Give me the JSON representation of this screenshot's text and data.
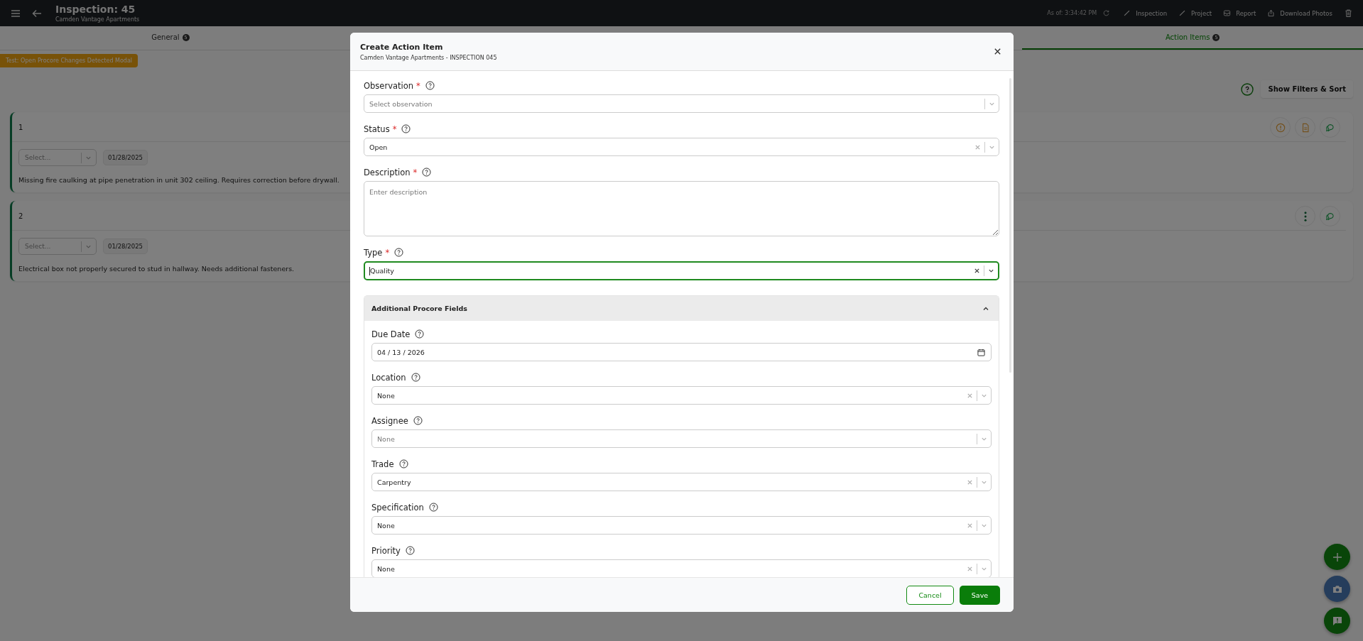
{
  "header": {
    "title": "Inspection: 45",
    "subtitle": "Camden Vantage Apartments",
    "as_of": "As of: 3:34:42 PM",
    "actions": [
      {
        "kind": "pencil",
        "label": "Inspection"
      },
      {
        "kind": "pencil",
        "label": "Project"
      },
      {
        "kind": "report",
        "label": "Report"
      },
      {
        "kind": "upload",
        "label": "Download Photos"
      }
    ]
  },
  "tabs": [
    {
      "label": "General",
      "badge": "5",
      "selected": false
    },
    {
      "label": "Action Items",
      "badge": "5",
      "selected": true
    }
  ],
  "test_button": "Test: Open Procore Changes Detected Modal",
  "filters_button": "Show Filters & Sort",
  "cards": [
    {
      "number": "1",
      "status_placeholder": "Select...",
      "date": "01/28/2025",
      "description": "Missing fire caulking at pipe penetration in unit 302 ceiling. Requires correction before drywall.",
      "actions": [
        {
          "kind": "alert"
        },
        {
          "kind": "document"
        },
        {
          "kind": "chat"
        }
      ]
    },
    {
      "number": "2",
      "status_placeholder": "Select...",
      "date": "01/28/2025",
      "description": "Electrical box not properly secured to stud in hallway. Needs additional fasteners.",
      "actions": [
        {
          "kind": "more"
        },
        {
          "kind": "chat"
        }
      ]
    }
  ],
  "modal": {
    "title": "Create Action Item",
    "subtitle": "Camden Vantage Apartments - INSPECTION 045",
    "fields": [
      {
        "kind": "select",
        "label": "Observation",
        "required_mark": "*",
        "placeholder": "Select observation",
        "clearable": false,
        "focused": false
      },
      {
        "kind": "select",
        "label": "Status",
        "required_mark": "*",
        "value": "Open",
        "clearable": true,
        "focused": false
      },
      {
        "kind": "textarea",
        "label": "Description",
        "required_mark": "*",
        "placeholder": "Enter description"
      },
      {
        "kind": "select",
        "label": "Type",
        "required_mark": "*",
        "value": "Quality",
        "clearable": true,
        "focused": true
      }
    ],
    "section": {
      "title": "Additional Procore Fields",
      "expanded": true,
      "fields": [
        {
          "kind": "date",
          "label": "Due Date",
          "value": "04 / 13 / 2026"
        },
        {
          "kind": "select",
          "label": "Location",
          "value": "None",
          "clearable": true,
          "focused": false
        },
        {
          "kind": "select",
          "label": "Assignee",
          "placeholder": "None",
          "clearable": false,
          "focused": false
        },
        {
          "kind": "select",
          "label": "Trade",
          "value": "Carpentry",
          "clearable": true,
          "focused": false
        },
        {
          "kind": "select",
          "label": "Specification",
          "value": "None",
          "clearable": true,
          "focused": false
        },
        {
          "kind": "select",
          "label": "Priority",
          "value": "None",
          "clearable": true,
          "focused": false
        }
      ]
    },
    "cancel": "Cancel",
    "save": "Save"
  },
  "fabs": [
    {
      "kind": "add"
    },
    {
      "kind": "camera"
    },
    {
      "kind": "feedback"
    }
  ]
}
